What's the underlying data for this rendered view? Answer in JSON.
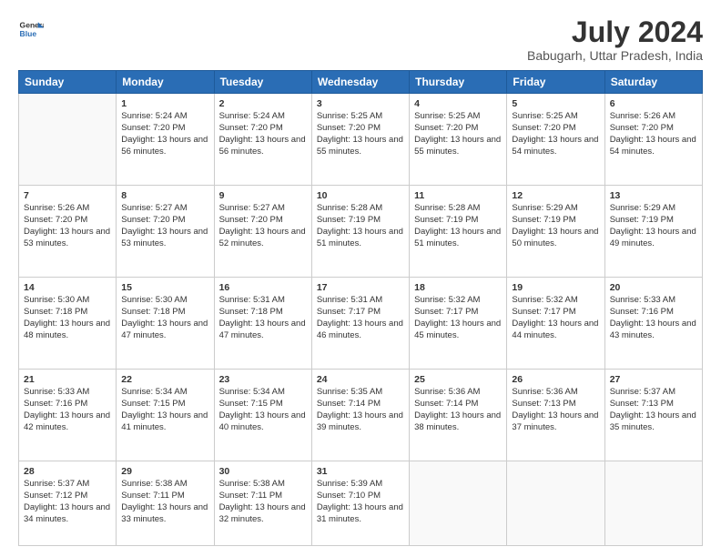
{
  "header": {
    "logo_line1": "General",
    "logo_line2": "Blue",
    "month": "July 2024",
    "location": "Babugarh, Uttar Pradesh, India"
  },
  "columns": [
    "Sunday",
    "Monday",
    "Tuesday",
    "Wednesday",
    "Thursday",
    "Friday",
    "Saturday"
  ],
  "weeks": [
    [
      {
        "day": "",
        "sunrise": "",
        "sunset": "",
        "daylight": ""
      },
      {
        "day": "1",
        "sunrise": "Sunrise: 5:24 AM",
        "sunset": "Sunset: 7:20 PM",
        "daylight": "Daylight: 13 hours and 56 minutes."
      },
      {
        "day": "2",
        "sunrise": "Sunrise: 5:24 AM",
        "sunset": "Sunset: 7:20 PM",
        "daylight": "Daylight: 13 hours and 56 minutes."
      },
      {
        "day": "3",
        "sunrise": "Sunrise: 5:25 AM",
        "sunset": "Sunset: 7:20 PM",
        "daylight": "Daylight: 13 hours and 55 minutes."
      },
      {
        "day": "4",
        "sunrise": "Sunrise: 5:25 AM",
        "sunset": "Sunset: 7:20 PM",
        "daylight": "Daylight: 13 hours and 55 minutes."
      },
      {
        "day": "5",
        "sunrise": "Sunrise: 5:25 AM",
        "sunset": "Sunset: 7:20 PM",
        "daylight": "Daylight: 13 hours and 54 minutes."
      },
      {
        "day": "6",
        "sunrise": "Sunrise: 5:26 AM",
        "sunset": "Sunset: 7:20 PM",
        "daylight": "Daylight: 13 hours and 54 minutes."
      }
    ],
    [
      {
        "day": "7",
        "sunrise": "Sunrise: 5:26 AM",
        "sunset": "Sunset: 7:20 PM",
        "daylight": "Daylight: 13 hours and 53 minutes."
      },
      {
        "day": "8",
        "sunrise": "Sunrise: 5:27 AM",
        "sunset": "Sunset: 7:20 PM",
        "daylight": "Daylight: 13 hours and 53 minutes."
      },
      {
        "day": "9",
        "sunrise": "Sunrise: 5:27 AM",
        "sunset": "Sunset: 7:20 PM",
        "daylight": "Daylight: 13 hours and 52 minutes."
      },
      {
        "day": "10",
        "sunrise": "Sunrise: 5:28 AM",
        "sunset": "Sunset: 7:19 PM",
        "daylight": "Daylight: 13 hours and 51 minutes."
      },
      {
        "day": "11",
        "sunrise": "Sunrise: 5:28 AM",
        "sunset": "Sunset: 7:19 PM",
        "daylight": "Daylight: 13 hours and 51 minutes."
      },
      {
        "day": "12",
        "sunrise": "Sunrise: 5:29 AM",
        "sunset": "Sunset: 7:19 PM",
        "daylight": "Daylight: 13 hours and 50 minutes."
      },
      {
        "day": "13",
        "sunrise": "Sunrise: 5:29 AM",
        "sunset": "Sunset: 7:19 PM",
        "daylight": "Daylight: 13 hours and 49 minutes."
      }
    ],
    [
      {
        "day": "14",
        "sunrise": "Sunrise: 5:30 AM",
        "sunset": "Sunset: 7:18 PM",
        "daylight": "Daylight: 13 hours and 48 minutes."
      },
      {
        "day": "15",
        "sunrise": "Sunrise: 5:30 AM",
        "sunset": "Sunset: 7:18 PM",
        "daylight": "Daylight: 13 hours and 47 minutes."
      },
      {
        "day": "16",
        "sunrise": "Sunrise: 5:31 AM",
        "sunset": "Sunset: 7:18 PM",
        "daylight": "Daylight: 13 hours and 47 minutes."
      },
      {
        "day": "17",
        "sunrise": "Sunrise: 5:31 AM",
        "sunset": "Sunset: 7:17 PM",
        "daylight": "Daylight: 13 hours and 46 minutes."
      },
      {
        "day": "18",
        "sunrise": "Sunrise: 5:32 AM",
        "sunset": "Sunset: 7:17 PM",
        "daylight": "Daylight: 13 hours and 45 minutes."
      },
      {
        "day": "19",
        "sunrise": "Sunrise: 5:32 AM",
        "sunset": "Sunset: 7:17 PM",
        "daylight": "Daylight: 13 hours and 44 minutes."
      },
      {
        "day": "20",
        "sunrise": "Sunrise: 5:33 AM",
        "sunset": "Sunset: 7:16 PM",
        "daylight": "Daylight: 13 hours and 43 minutes."
      }
    ],
    [
      {
        "day": "21",
        "sunrise": "Sunrise: 5:33 AM",
        "sunset": "Sunset: 7:16 PM",
        "daylight": "Daylight: 13 hours and 42 minutes."
      },
      {
        "day": "22",
        "sunrise": "Sunrise: 5:34 AM",
        "sunset": "Sunset: 7:15 PM",
        "daylight": "Daylight: 13 hours and 41 minutes."
      },
      {
        "day": "23",
        "sunrise": "Sunrise: 5:34 AM",
        "sunset": "Sunset: 7:15 PM",
        "daylight": "Daylight: 13 hours and 40 minutes."
      },
      {
        "day": "24",
        "sunrise": "Sunrise: 5:35 AM",
        "sunset": "Sunset: 7:14 PM",
        "daylight": "Daylight: 13 hours and 39 minutes."
      },
      {
        "day": "25",
        "sunrise": "Sunrise: 5:36 AM",
        "sunset": "Sunset: 7:14 PM",
        "daylight": "Daylight: 13 hours and 38 minutes."
      },
      {
        "day": "26",
        "sunrise": "Sunrise: 5:36 AM",
        "sunset": "Sunset: 7:13 PM",
        "daylight": "Daylight: 13 hours and 37 minutes."
      },
      {
        "day": "27",
        "sunrise": "Sunrise: 5:37 AM",
        "sunset": "Sunset: 7:13 PM",
        "daylight": "Daylight: 13 hours and 35 minutes."
      }
    ],
    [
      {
        "day": "28",
        "sunrise": "Sunrise: 5:37 AM",
        "sunset": "Sunset: 7:12 PM",
        "daylight": "Daylight: 13 hours and 34 minutes."
      },
      {
        "day": "29",
        "sunrise": "Sunrise: 5:38 AM",
        "sunset": "Sunset: 7:11 PM",
        "daylight": "Daylight: 13 hours and 33 minutes."
      },
      {
        "day": "30",
        "sunrise": "Sunrise: 5:38 AM",
        "sunset": "Sunset: 7:11 PM",
        "daylight": "Daylight: 13 hours and 32 minutes."
      },
      {
        "day": "31",
        "sunrise": "Sunrise: 5:39 AM",
        "sunset": "Sunset: 7:10 PM",
        "daylight": "Daylight: 13 hours and 31 minutes."
      },
      {
        "day": "",
        "sunrise": "",
        "sunset": "",
        "daylight": ""
      },
      {
        "day": "",
        "sunrise": "",
        "sunset": "",
        "daylight": ""
      },
      {
        "day": "",
        "sunrise": "",
        "sunset": "",
        "daylight": ""
      }
    ]
  ]
}
